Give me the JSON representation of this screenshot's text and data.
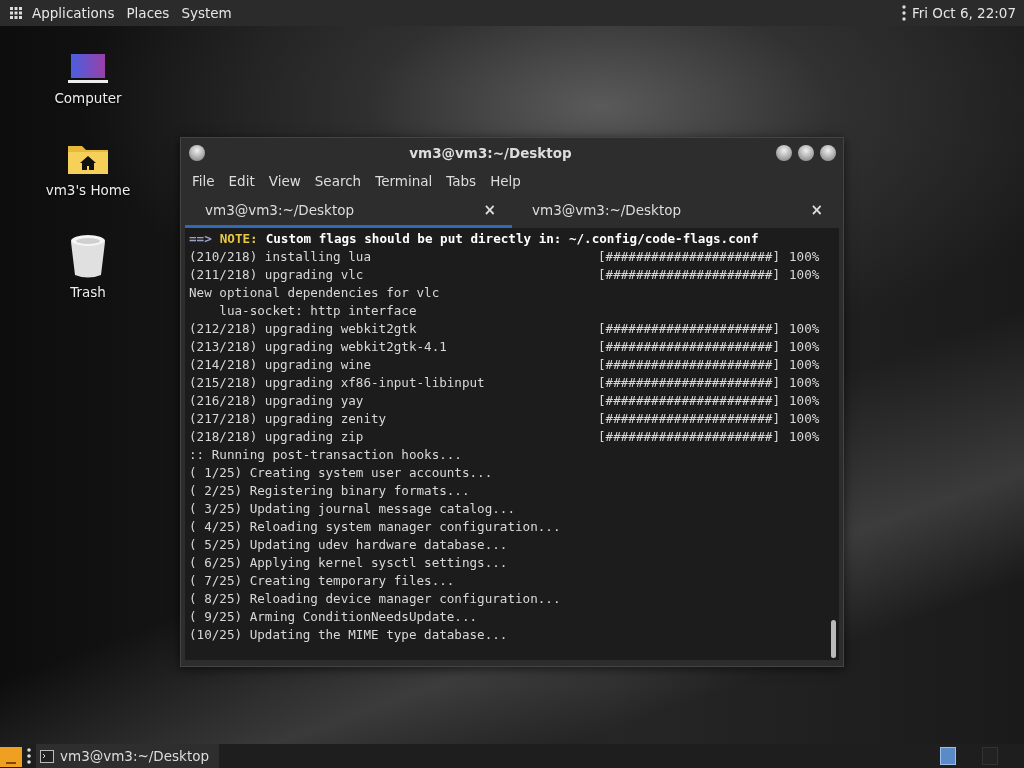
{
  "top_panel": {
    "menus": [
      "Applications",
      "Places",
      "System"
    ],
    "clock": "Fri Oct 6, 22:07"
  },
  "desktop_icons": [
    {
      "kind": "computer",
      "label": "Computer"
    },
    {
      "kind": "home",
      "label": "vm3's Home"
    },
    {
      "kind": "trash",
      "label": "Trash"
    }
  ],
  "window": {
    "title": "vm3@vm3:~/Desktop",
    "menu": [
      "File",
      "Edit",
      "View",
      "Search",
      "Terminal",
      "Tabs",
      "Help"
    ],
    "tabs": [
      {
        "label": "vm3@vm3:~/Desktop",
        "close": "×",
        "selected": true
      },
      {
        "label": "vm3@vm3:~/Desktop",
        "close": "×",
        "selected": false
      }
    ],
    "lines": [
      {
        "kind": "note",
        "arrow": "==>",
        "label": "NOTE:",
        "text": "Custom flags should be put directly in: ~/.config/code-flags.conf"
      },
      {
        "kind": "progress",
        "text": "(210/218) installing lua",
        "bar": "[######################]",
        "percent": "100%"
      },
      {
        "kind": "progress",
        "text": "(211/218) upgrading vlc",
        "bar": "[######################]",
        "percent": "100%"
      },
      {
        "kind": "plain",
        "text": "New optional dependencies for vlc"
      },
      {
        "kind": "plain",
        "text": "    lua-socket: http interface"
      },
      {
        "kind": "progress",
        "text": "(212/218) upgrading webkit2gtk",
        "bar": "[######################]",
        "percent": "100%"
      },
      {
        "kind": "progress",
        "text": "(213/218) upgrading webkit2gtk-4.1",
        "bar": "[######################]",
        "percent": "100%"
      },
      {
        "kind": "progress",
        "text": "(214/218) upgrading wine",
        "bar": "[######################]",
        "percent": "100%"
      },
      {
        "kind": "progress",
        "text": "(215/218) upgrading xf86-input-libinput",
        "bar": "[######################]",
        "percent": "100%"
      },
      {
        "kind": "progress",
        "text": "(216/218) upgrading yay",
        "bar": "[######################]",
        "percent": "100%"
      },
      {
        "kind": "progress",
        "text": "(217/218) upgrading zenity",
        "bar": "[######################]",
        "percent": "100%"
      },
      {
        "kind": "progress",
        "text": "(218/218) upgrading zip",
        "bar": "[######################]",
        "percent": "100%"
      },
      {
        "kind": "plain",
        "text": ":: Running post-transaction hooks..."
      },
      {
        "kind": "plain",
        "text": "( 1/25) Creating system user accounts..."
      },
      {
        "kind": "plain",
        "text": "( 2/25) Registering binary formats..."
      },
      {
        "kind": "plain",
        "text": "( 3/25) Updating journal message catalog..."
      },
      {
        "kind": "plain",
        "text": "( 4/25) Reloading system manager configuration..."
      },
      {
        "kind": "plain",
        "text": "( 5/25) Updating udev hardware database..."
      },
      {
        "kind": "plain",
        "text": "( 6/25) Applying kernel sysctl settings..."
      },
      {
        "kind": "plain",
        "text": "( 7/25) Creating temporary files..."
      },
      {
        "kind": "plain",
        "text": "( 8/25) Reloading device manager configuration..."
      },
      {
        "kind": "plain",
        "text": "( 9/25) Arming ConditionNeedsUpdate..."
      },
      {
        "kind": "plain",
        "text": "(10/25) Updating the MIME type database..."
      }
    ]
  },
  "taskbar": {
    "tasks": [
      {
        "label": "vm3@vm3:~/Desktop"
      }
    ],
    "workspaces": [
      {
        "selected": true
      },
      {
        "selected": false
      }
    ]
  }
}
